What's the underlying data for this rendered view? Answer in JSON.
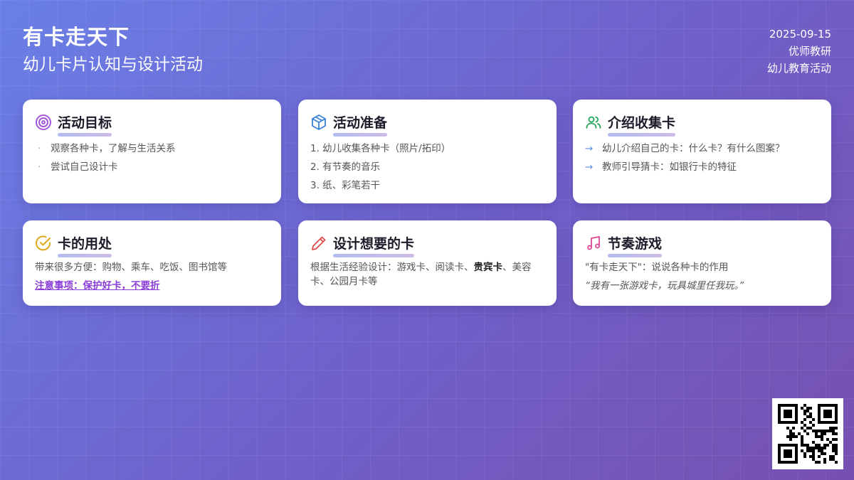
{
  "header": {
    "title": "有卡走天下",
    "subtitle": "幼儿卡片认知与设计活动"
  },
  "meta": {
    "date": "2025-09-15",
    "author": "优师教研",
    "category": "幼儿教育活动"
  },
  "cards": {
    "goal": {
      "icon": "target-icon",
      "title": "活动目标",
      "items": [
        "观察各种卡，了解与生活关系",
        "尝试自己设计卡"
      ]
    },
    "prep": {
      "icon": "box-icon",
      "title": "活动准备",
      "items": [
        "1. 幼儿收集各种卡（照片/拓印）",
        "2. 有节奏的音乐",
        "3. 纸、彩笔若干"
      ]
    },
    "intro": {
      "icon": "users-icon",
      "title": "介绍收集卡",
      "items": [
        "幼儿介绍自己的卡：什么卡？有什么图案？",
        "教师引导猜卡：如银行卡的特征"
      ]
    },
    "use": {
      "icon": "check-circle-icon",
      "title": "卡的用处",
      "text": "带来很多方便：购物、乘车、吃饭、图书馆等",
      "note": "注意事项：保护好卡，不要折"
    },
    "design": {
      "icon": "pencil-icon",
      "title": "设计想要的卡",
      "text_before": "根据生活经验设计：游戏卡、阅读卡、",
      "text_bold": "贵宾卡",
      "text_after": "、美容卡、公园月卡等"
    },
    "game": {
      "icon": "music-icon",
      "title": "节奏游戏",
      "text": "\"有卡走天下\"：说说各种卡的作用",
      "quote": "“我有一张游戏卡，玩具城里任我玩。”"
    }
  },
  "colors": {
    "accent": "#8a3cd8",
    "target": "#a259d9",
    "box": "#3b82d6",
    "users": "#22a65a",
    "check": "#e0a81a",
    "pencil": "#e04a4a",
    "music": "#e0489a"
  },
  "qr": {
    "icon": "qr-code-icon"
  }
}
